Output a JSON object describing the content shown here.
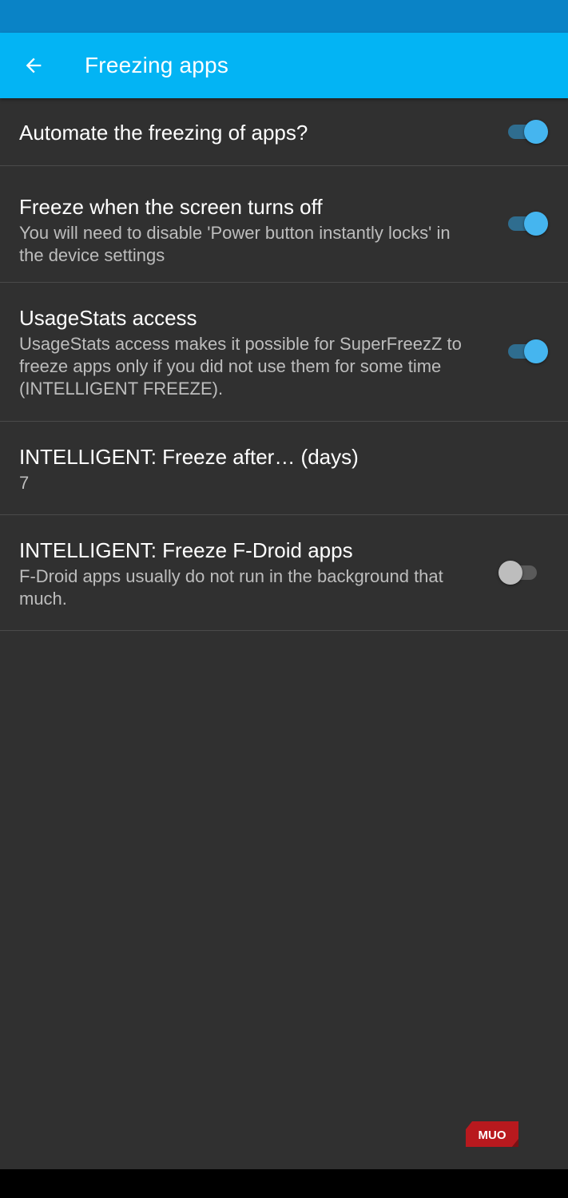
{
  "header": {
    "title": "Freezing apps",
    "back_icon": "arrow-back-icon"
  },
  "colors": {
    "status_bar": "#0a83c6",
    "app_bar": "#03b4f4",
    "background": "#303030",
    "accent": "#45b5ef"
  },
  "preferences": [
    {
      "title": "Automate the freezing of apps?",
      "summary": "",
      "switch": "on"
    },
    {
      "title": "Freeze when the screen turns off",
      "summary": "You will need to disable 'Power button instantly locks' in the device settings",
      "switch": "on"
    },
    {
      "title": "UsageStats access",
      "summary": "UsageStats access makes it possible for SuperFreezZ to freeze apps only if you did not use them for some time (INTELLIGENT FREEZE).",
      "switch": "on"
    },
    {
      "title": "INTELLIGENT: Freeze after… (days)",
      "summary": "7"
    },
    {
      "title": "INTELLIGENT: Freeze F-Droid apps",
      "summary": "F-Droid apps usually do not run in the background that much.",
      "switch": "off"
    }
  ],
  "watermark": {
    "text": "MUO"
  }
}
